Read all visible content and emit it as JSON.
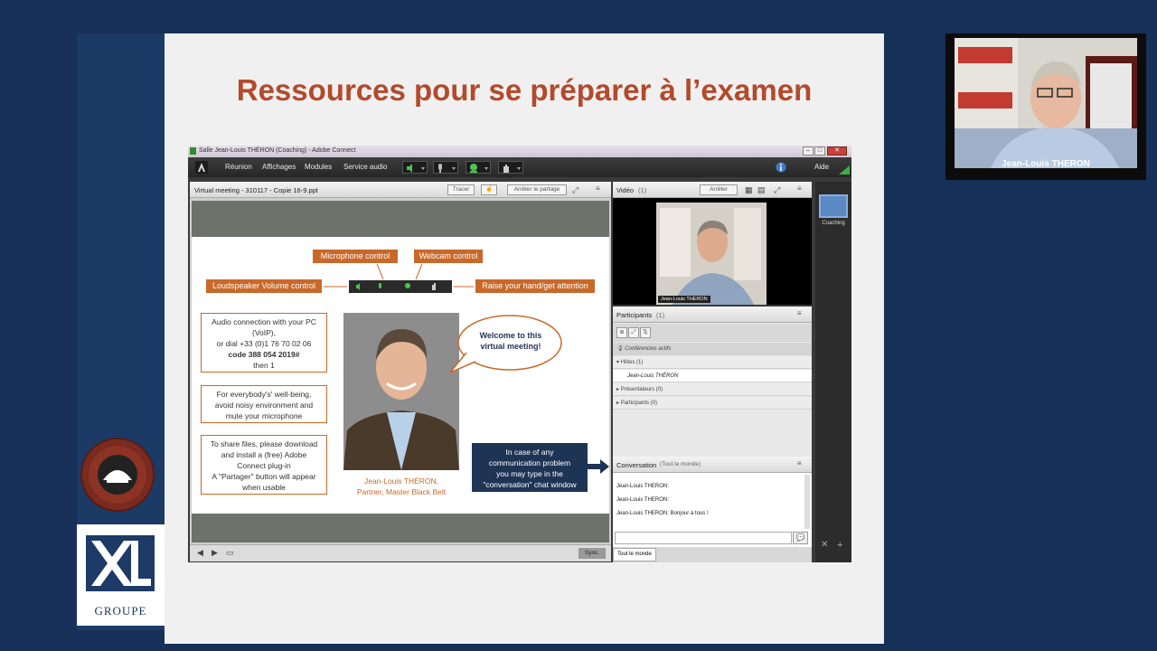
{
  "slide": {
    "title": "Ressources pour se préparer à l’examen"
  },
  "brand": {
    "groupe_label": "GROUPE"
  },
  "webcam": {
    "name": "Jean-Louis THERON"
  },
  "app": {
    "window_title": "Salle Jean-Louis THÉRON (Coaching) - Adobe Connect",
    "menu": [
      "Réunion",
      "Affichages",
      "Modules",
      "Service audio"
    ],
    "help_label": "Aide"
  },
  "share_pod": {
    "file_title": "Virtual meeting - 310117 - Copie 16-9.ppt",
    "draw_btn": "Tracer",
    "stop_share_btn": "Arrêter le partage",
    "sync_btn": "Sync."
  },
  "embedded_slide": {
    "labels": {
      "microphone": "Microphone control",
      "webcam": "Webcam control",
      "loudspeaker": "Loudspeaker Volume control",
      "raise_hand": "Raise your hand/get attention"
    },
    "audio_box": [
      "Audio connection with your PC",
      "(VoIP),",
      "or dial +33 (0)1 76 70 02 06",
      "code 388 054 2019#",
      "then 1"
    ],
    "wellbeing_box": [
      "For everybody's' well-being,",
      "avoid noisy environment and",
      "mute your microphone"
    ],
    "share_box": [
      "To share files, please download",
      "and install a (free) Adobe",
      "Connect plug-in",
      "A \"Partager\" button will appear",
      "when usable"
    ],
    "welcome_bubble": [
      "Welcome to this",
      "virtual meeting!"
    ],
    "caption": [
      "Jean-Louis THÉRON,",
      "Partner, Master Black Belt"
    ],
    "problem_box": [
      "In case of any",
      "communication problem",
      "you may type in the",
      "\"conversation\" chat window"
    ]
  },
  "video_pod": {
    "title": "Vidéo",
    "count": "(1)",
    "stop_btn": "Arrêter",
    "cam_label": "Jean-Louis THERON"
  },
  "participants_pod": {
    "title": "Participants",
    "count": "(1)",
    "rows": {
      "conf": "Conférencies actifs",
      "hosts": "Hôtes (1)",
      "host_name": "Jean-Louis THÉRON",
      "presenters": "Présentateurs (0)",
      "participants": "Participants (0)"
    }
  },
  "conversation_pod": {
    "title": "Conversation",
    "scope": "(Tout le monde)",
    "messages": [
      "Jean-Louis THERON:",
      "Jean-Louis THERON:",
      "Jean-Louis THERON: Bonjour à tous !"
    ],
    "tab": "Tout le monde"
  },
  "layouts": {
    "coaching_label": "Coaching"
  },
  "colors": {
    "background": "#173058",
    "title_red": "#b34a2c",
    "accent_orange": "#c8692a"
  }
}
